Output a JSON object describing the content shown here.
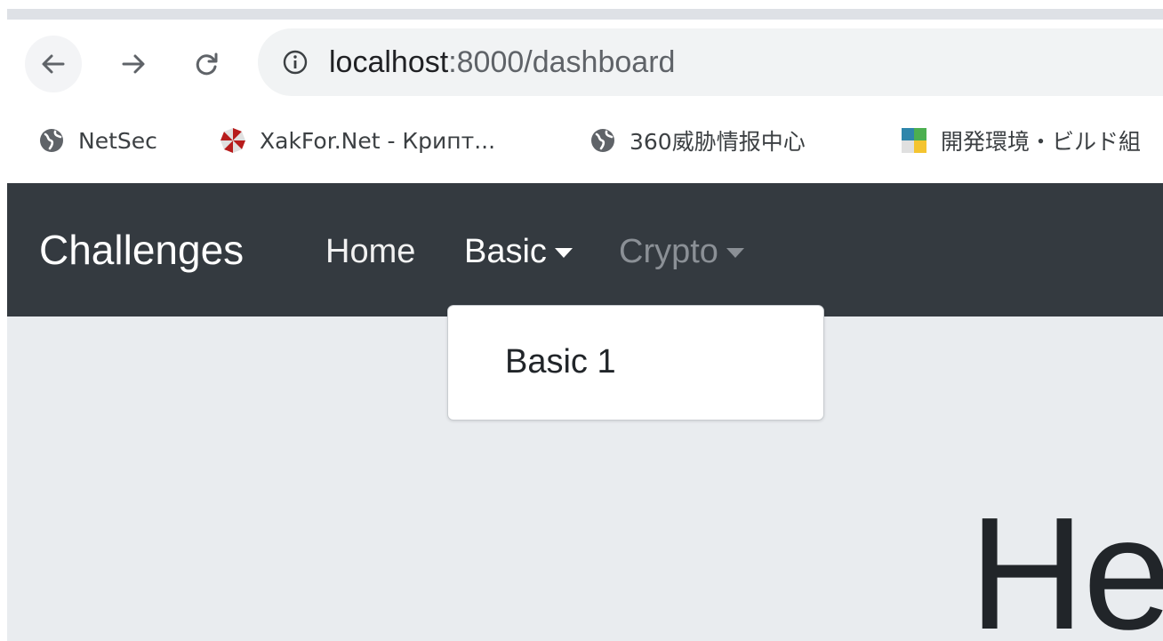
{
  "browser": {
    "url_host": "localhost",
    "url_rest": ":8000/dashboard",
    "bookmarks": [
      {
        "label": "NetSec",
        "icon": "globe-icon"
      },
      {
        "label": "XakFor.Net - Крипт...",
        "icon": "umbrella-logo-icon"
      },
      {
        "label": "360威胁情报中心",
        "icon": "globe-icon"
      },
      {
        "label": "開発環境・ビルド組",
        "icon": "colored-squares-icon"
      }
    ]
  },
  "navbar": {
    "brand": "Challenges",
    "home": "Home",
    "basic": "Basic",
    "crypto": "Crypto"
  },
  "dropdown": {
    "items": [
      "Basic 1"
    ]
  },
  "page": {
    "heading_partial": "He"
  },
  "colors": {
    "navbar_bg": "#343a40",
    "page_bg": "#e9ecef",
    "omnibox_bg": "#f1f3f4"
  }
}
